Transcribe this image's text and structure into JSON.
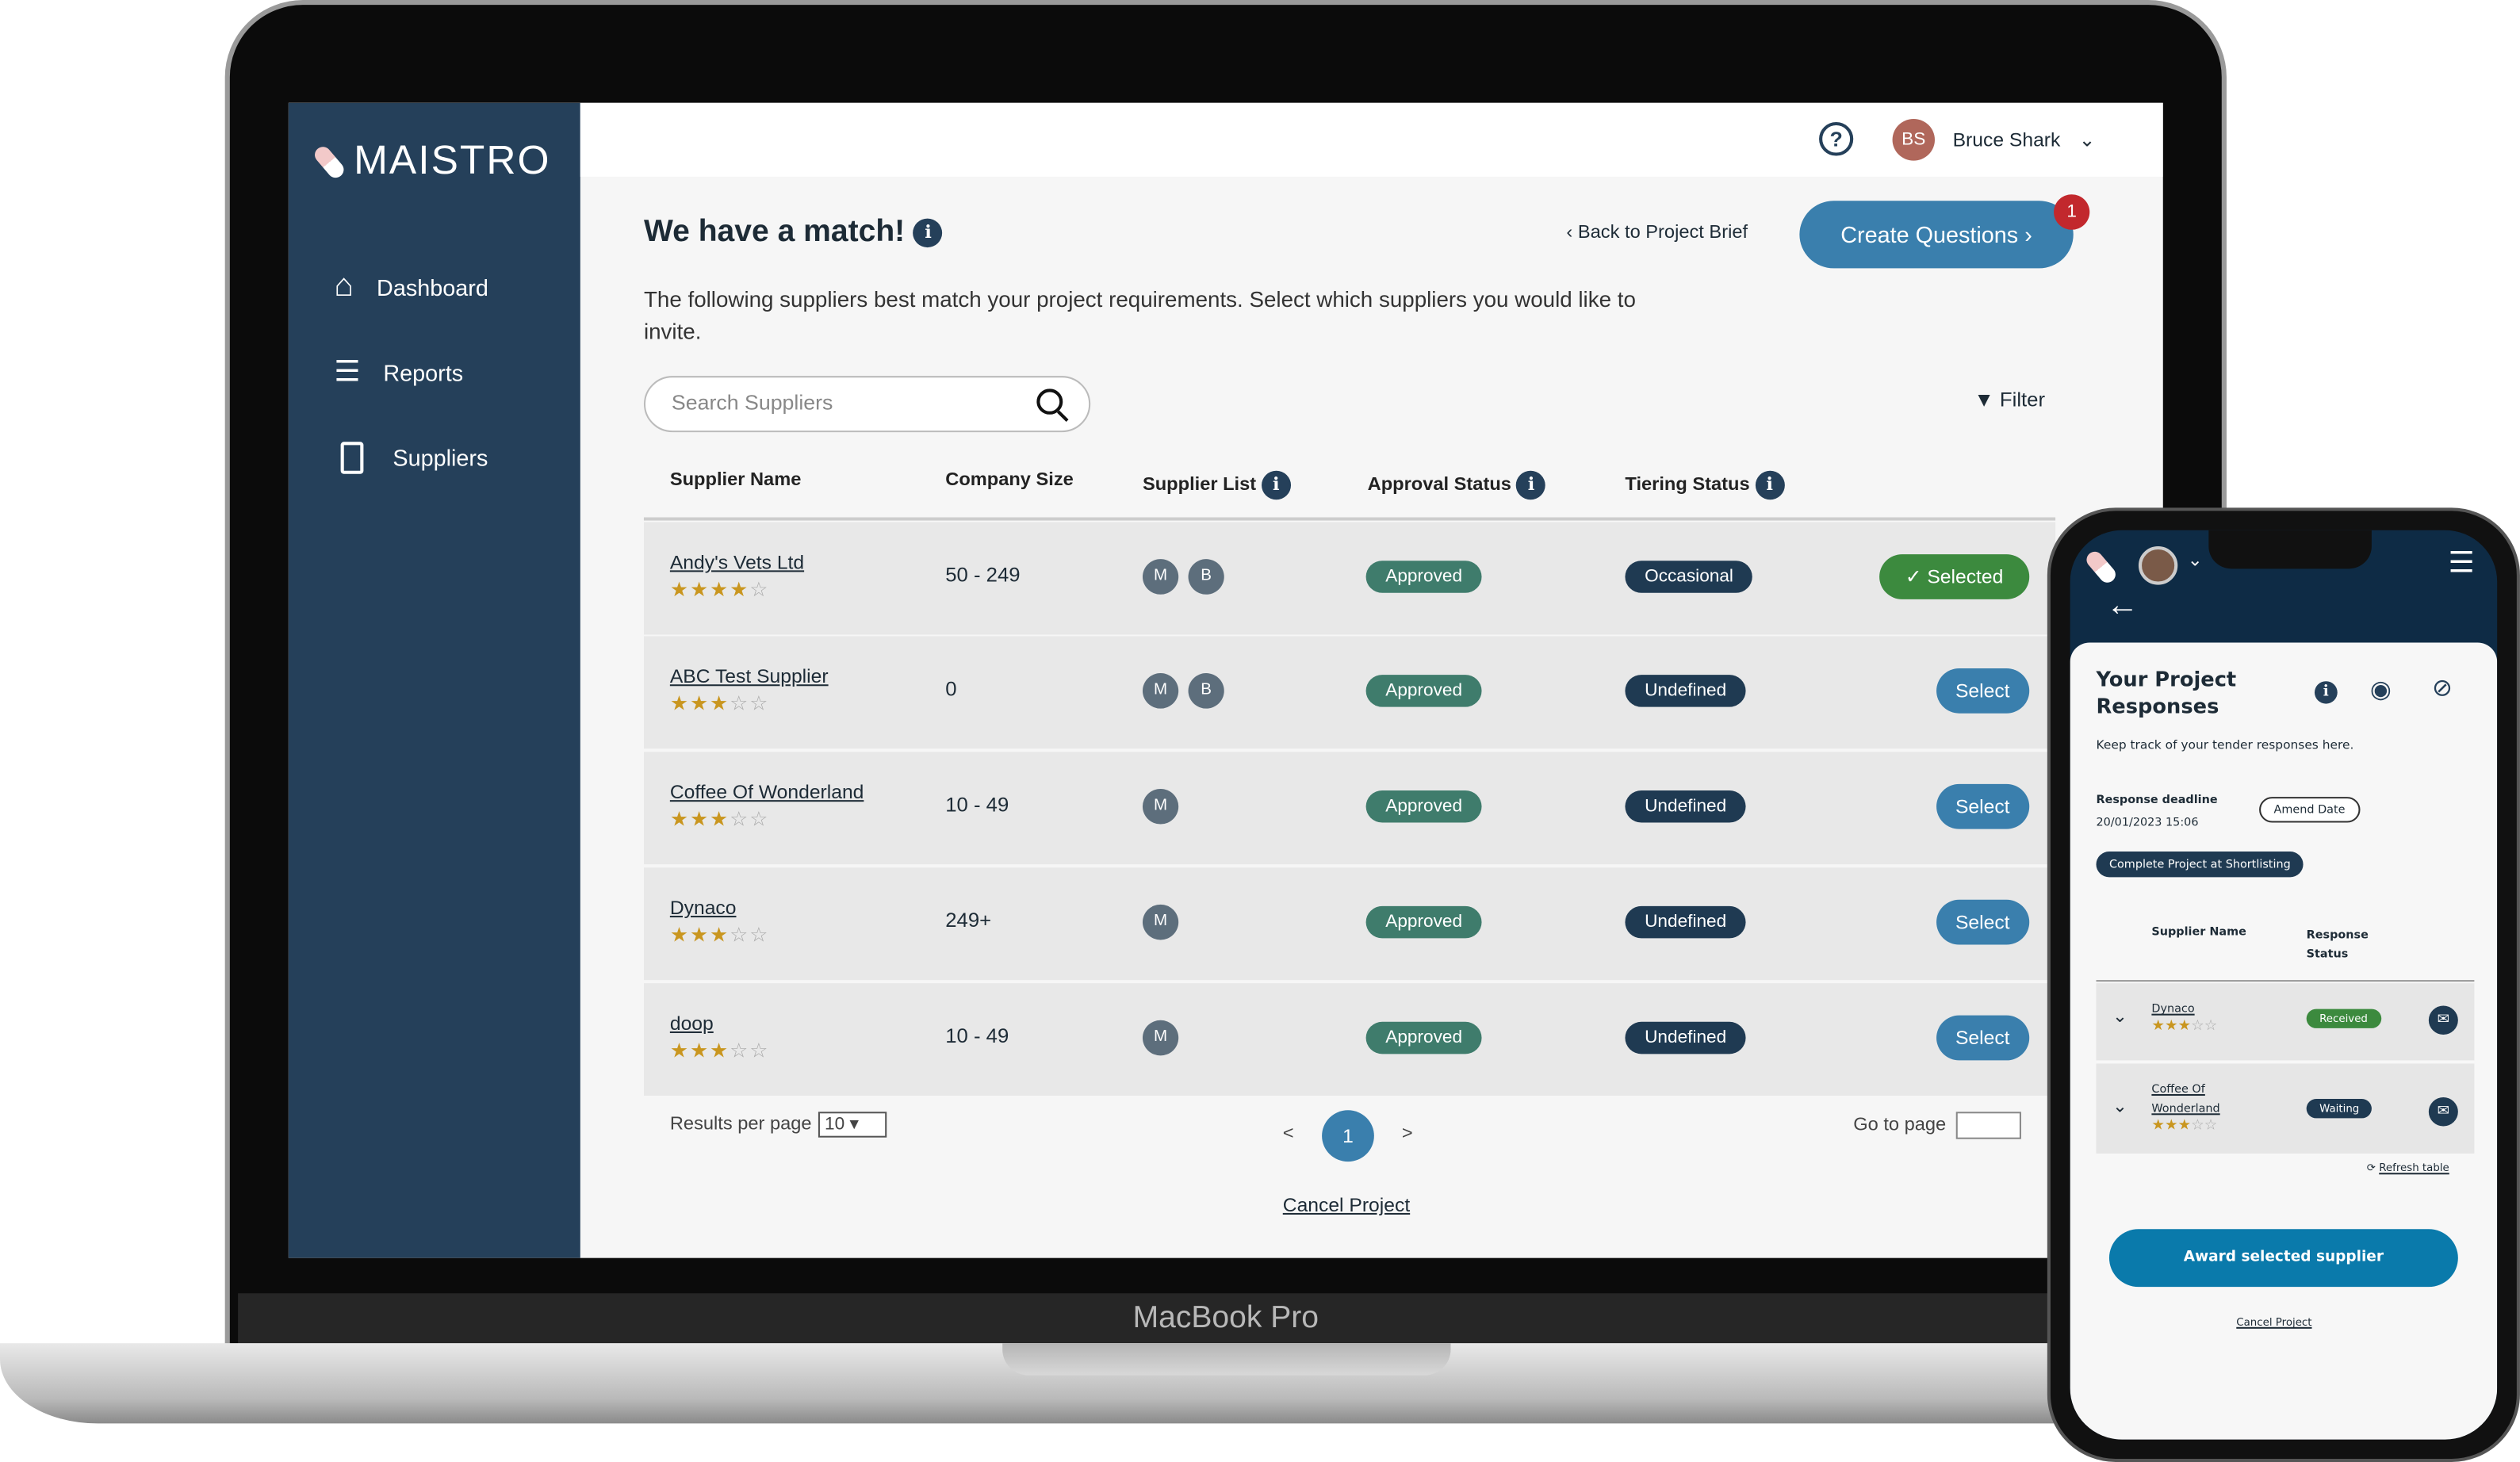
{
  "brand": "MAISTRO",
  "sidebar": {
    "items": [
      {
        "label": "Dashboard",
        "icon": "home-icon"
      },
      {
        "label": "Reports",
        "icon": "reports-icon"
      },
      {
        "label": "Suppliers",
        "icon": "building-icon"
      }
    ]
  },
  "topbar": {
    "user_initials": "BS",
    "user_name": "Bruce Shark"
  },
  "main": {
    "title": "We have a match!",
    "back_label": "Back to Project Brief",
    "create_questions_label": "Create Questions",
    "create_questions_badge": "1",
    "description": "The following suppliers best match your project requirements. Select which suppliers you would like to invite.",
    "search_placeholder": "Search Suppliers",
    "filter_label": "Filter",
    "columns": [
      "Supplier Name",
      "Company Size",
      "Supplier List",
      "Approval Status",
      "Tiering Status"
    ],
    "rows": [
      {
        "name": "Andy's Vets Ltd",
        "rating": 4,
        "size": "50 - 249",
        "lists": [
          "M",
          "B"
        ],
        "approval": "Approved",
        "tiering": "Occasional",
        "action": "Selected"
      },
      {
        "name": "ABC Test Supplier",
        "rating": 3,
        "size": "0",
        "lists": [
          "M",
          "B"
        ],
        "approval": "Approved",
        "tiering": "Undefined",
        "action": "Select"
      },
      {
        "name": "Coffee Of Wonderland",
        "rating": 3,
        "size": "10 - 49",
        "lists": [
          "M"
        ],
        "approval": "Approved",
        "tiering": "Undefined",
        "action": "Select"
      },
      {
        "name": "Dynaco",
        "rating": 3,
        "size": "249+",
        "lists": [
          "M"
        ],
        "approval": "Approved",
        "tiering": "Undefined",
        "action": "Select"
      },
      {
        "name": "doop",
        "rating": 3,
        "size": "10 - 49",
        "lists": [
          "M"
        ],
        "approval": "Approved",
        "tiering": "Undefined",
        "action": "Select"
      }
    ],
    "results_per_page_label": "Results per page",
    "results_per_page": "10",
    "prev": "<",
    "page": "1",
    "next": ">",
    "goto_label": "Go to page",
    "cancel_label": "Cancel Project"
  },
  "laptop_label": "MacBook Pro",
  "phone": {
    "title": "Your Project Responses",
    "subtitle": "Keep track of your tender responses here.",
    "deadline_label": "Response deadline",
    "deadline": "20/01/2023 15:06",
    "amend_label": "Amend Date",
    "complete_label": "Complete Project at Shortlisting",
    "col_name": "Supplier Name",
    "col_status": "Response Status",
    "rows": [
      {
        "name": "Dynaco",
        "rating": 3,
        "status": "Received"
      },
      {
        "name": "Coffee Of Wonderland",
        "rating": 3,
        "status": "Waiting"
      }
    ],
    "refresh_label": "Refresh table",
    "award_label": "Award selected supplier",
    "cancel_label": "Cancel Project"
  },
  "colors": {
    "sidebar": "#25405a",
    "primary": "#3a7fad",
    "approved": "#3f7c6c",
    "selected": "#3c8a3e",
    "star": "#c9961f",
    "badge": "#c2282d"
  }
}
